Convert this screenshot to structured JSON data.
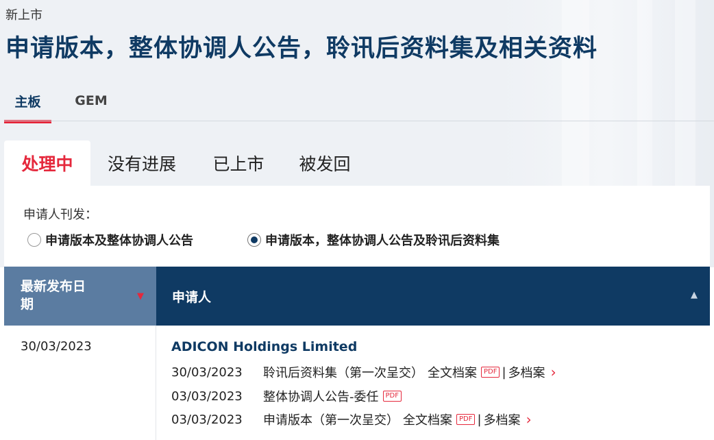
{
  "breadcrumb": "新上市",
  "page_title": "申请版本，整体协调人公告，聆讯后资料集及相关资料",
  "board_tabs": [
    {
      "label": "主板",
      "active": true
    },
    {
      "label": "GEM",
      "active": false
    }
  ],
  "status_tabs": [
    {
      "label": "处理中",
      "active": true
    },
    {
      "label": "没有进展",
      "active": false
    },
    {
      "label": "已上市",
      "active": false
    },
    {
      "label": "被发回",
      "active": false
    }
  ],
  "filter": {
    "label": "申请人刊发：",
    "options": [
      {
        "label": "申请版本及整体协调人公告",
        "checked": false
      },
      {
        "label": "申请版本，整体协调人公告及聆讯后资料集",
        "checked": true
      }
    ]
  },
  "table": {
    "headers": {
      "date": "最新发布日期",
      "applicant": "申请人"
    },
    "sort_icons": {
      "date": "triangle-down",
      "applicant": "triangle-up"
    },
    "rows": [
      {
        "date": "30/03/2023",
        "company": "ADICON Holdings Limited",
        "documents": [
          {
            "date": "30/03/2023",
            "title": "聆讯后资料集（第一次呈交）",
            "full_text": "全文档案",
            "pdf": "PDF",
            "multi": "多档案"
          },
          {
            "date": "03/03/2023",
            "title": "整体协调人公告-委任",
            "pdf": "PDF"
          },
          {
            "date": "03/03/2023",
            "title": "申请版本（第一次呈交）",
            "full_text": "全文档案",
            "pdf": "PDF",
            "multi": "多档案"
          }
        ]
      }
    ]
  },
  "colors": {
    "accent_red": "#e5283c",
    "navy": "#0f3a63",
    "header_light": "#5b7ca1"
  }
}
